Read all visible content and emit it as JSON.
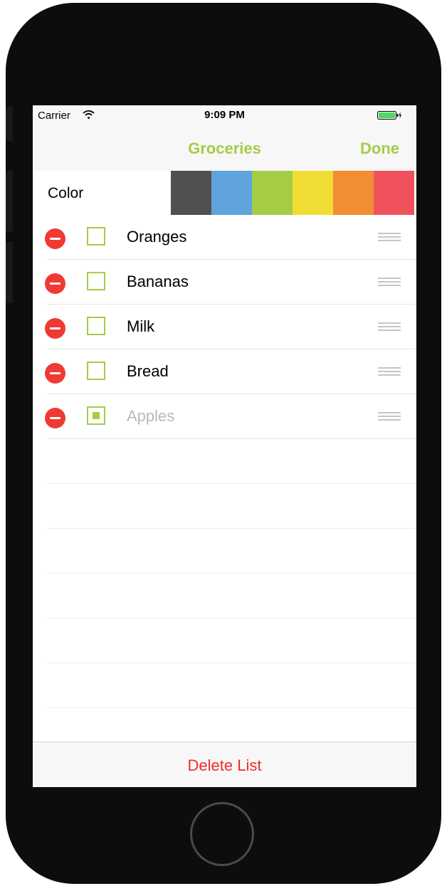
{
  "status_bar": {
    "carrier": "Carrier",
    "time": "9:09 PM"
  },
  "nav": {
    "title": "Groceries",
    "done_label": "Done"
  },
  "color_picker": {
    "label": "Color",
    "swatches": [
      "#505050",
      "#5fa4dc",
      "#a5cc45",
      "#f0dd33",
      "#f18d32",
      "#ef525c"
    ]
  },
  "items": [
    {
      "label": "Oranges",
      "checked": false
    },
    {
      "label": "Bananas",
      "checked": false
    },
    {
      "label": "Milk",
      "checked": false
    },
    {
      "label": "Bread",
      "checked": false
    },
    {
      "label": "Apples",
      "checked": true
    }
  ],
  "toolbar": {
    "delete_list_label": "Delete List"
  },
  "colors": {
    "accent": "#a5cc45",
    "destructive": "#f02b2b"
  }
}
